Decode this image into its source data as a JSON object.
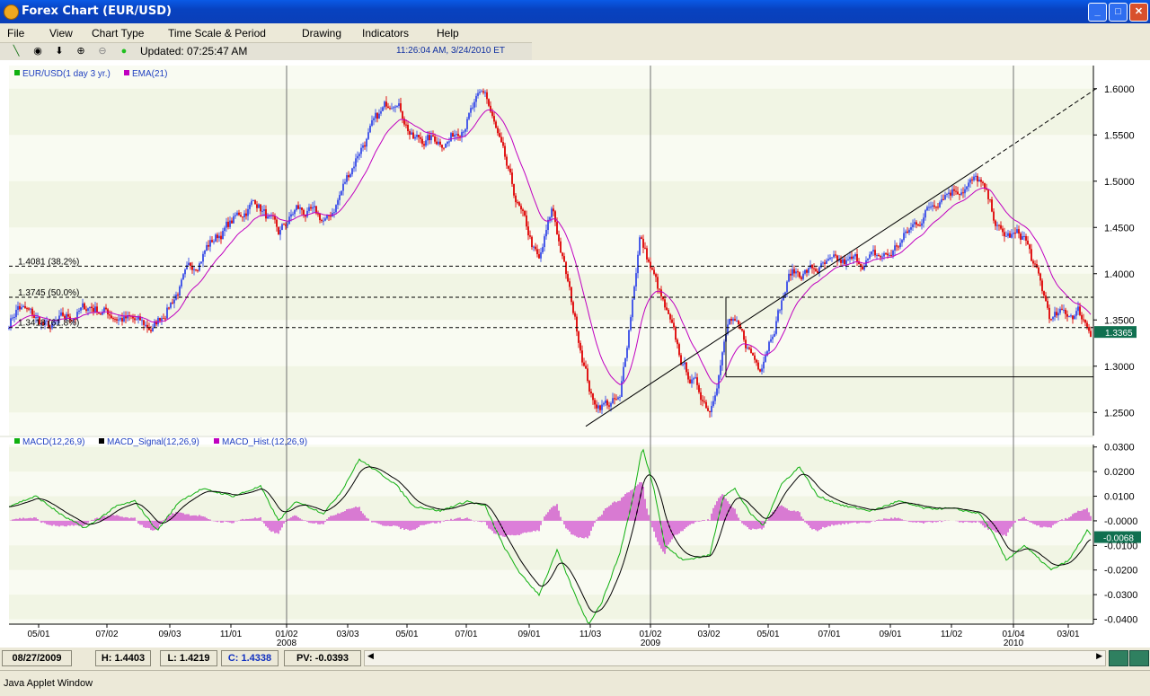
{
  "window": {
    "title": "Forex Chart (EUR/USD)",
    "minimize": "_",
    "maximize": "□",
    "close": "✕"
  },
  "menu": [
    "File",
    "View",
    "Chart Type",
    "Time Scale & Period",
    "Drawing",
    "Indicators",
    "Help"
  ],
  "toolbar": {
    "icons": [
      "pencil-icon",
      "target-icon",
      "down-arrow-icon",
      "zoom-in-icon",
      "zoom-out-icon",
      "status-dot-icon"
    ],
    "updated": "Updated: 07:25:47 AM",
    "server_time": "11:26:04 AM, 3/24/2010 ET"
  },
  "colors": {
    "up": "#4a5ce8",
    "down": "#e01818",
    "ema": "#c000c0",
    "macd": "#10b010",
    "signal": "#000000",
    "hist": "#c000c0",
    "band": "#f1f5e4",
    "price_tag": "#107050"
  },
  "chart_data": [
    {
      "type": "candlestick",
      "legend": [
        {
          "label": "EUR/USD(1 day  3 yr.)",
          "color": "#10b010"
        },
        {
          "label": "EMA(21)",
          "color": "#c000c0"
        }
      ],
      "ylim": [
        1.225,
        1.625
      ],
      "yticks": [
        "1.6000",
        "1.5500",
        "1.5000",
        "1.4500",
        "1.4000",
        "1.3500",
        "1.3000",
        "1.2500"
      ],
      "xticks": [
        "05/01",
        "07/02",
        "09/03",
        "11/01",
        "01/02",
        "03/03",
        "05/01",
        "07/01",
        "09/01",
        "11/03",
        "01/02",
        "03/02",
        "05/01",
        "07/01",
        "09/01",
        "11/02",
        "01/04",
        "03/01"
      ],
      "year_labels": [
        "2008",
        "2009",
        "2010"
      ],
      "fib_levels": [
        {
          "label": "1.4081 (38.2%)",
          "value": 1.4081
        },
        {
          "label": "1.3745 (50.0%)",
          "value": 1.3745
        },
        {
          "label": "1.3418 (61.8%)",
          "value": 1.3418
        }
      ],
      "last_price": "1.3365",
      "close_anchors": [
        [
          0,
          1.33
        ],
        [
          20,
          1.365
        ],
        [
          55,
          1.34
        ],
        [
          100,
          1.365
        ],
        [
          170,
          1.34
        ],
        [
          230,
          1.43
        ],
        [
          285,
          1.48
        ],
        [
          310,
          1.44
        ],
        [
          330,
          1.47
        ],
        [
          365,
          1.455
        ],
        [
          400,
          1.535
        ],
        [
          440,
          1.595
        ],
        [
          460,
          1.545
        ],
        [
          500,
          1.545
        ],
        [
          540,
          1.595
        ],
        [
          570,
          1.49
        ],
        [
          600,
          1.41
        ],
        [
          615,
          1.47
        ],
        [
          640,
          1.35
        ],
        [
          660,
          1.26
        ],
        [
          690,
          1.26
        ],
        [
          712,
          1.44
        ],
        [
          730,
          1.39
        ],
        [
          760,
          1.3
        ],
        [
          790,
          1.255
        ],
        [
          812,
          1.35
        ],
        [
          845,
          1.3
        ],
        [
          880,
          1.4
        ],
        [
          940,
          1.41
        ],
        [
          990,
          1.42
        ],
        [
          1050,
          1.49
        ],
        [
          1090,
          1.5
        ],
        [
          1115,
          1.44
        ],
        [
          1140,
          1.44
        ],
        [
          1170,
          1.35
        ],
        [
          1200,
          1.36
        ],
        [
          1217,
          1.336
        ]
      ],
      "trend_line": {
        "from": [
          "11/03/2008",
          1.235
        ],
        "to": [
          "03/24/2010",
          1.6
        ]
      },
      "support_line": {
        "value": 1.2885,
        "from": "03/02/2009",
        "to": "03/24/2010"
      }
    },
    {
      "type": "line",
      "legend": [
        {
          "label": "MACD(12,26,9)",
          "color": "#10b010"
        },
        {
          "label": "MACD_Signal(12,26,9)",
          "color": "#000000"
        },
        {
          "label": "MACD_Hist.(12,26,9)",
          "color": "#c000c0"
        }
      ],
      "ylim": [
        -0.042,
        0.031
      ],
      "yticks": [
        "0.0300",
        "0.0200",
        "0.0100",
        "-0.0000",
        "-0.0100",
        "-0.0200",
        "-0.0300",
        "-0.0400"
      ],
      "macd_anchors": [
        [
          10,
          0.006
        ],
        [
          40,
          0.01
        ],
        [
          70,
          0.002
        ],
        [
          95,
          -0.003
        ],
        [
          130,
          0.006
        ],
        [
          150,
          0.008
        ],
        [
          175,
          -0.004
        ],
        [
          200,
          0.008
        ],
        [
          225,
          0.013
        ],
        [
          260,
          0.01
        ],
        [
          290,
          0.014
        ],
        [
          310,
          0.0
        ],
        [
          330,
          0.008
        ],
        [
          360,
          0.003
        ],
        [
          380,
          0.012
        ],
        [
          400,
          0.025
        ],
        [
          420,
          0.02
        ],
        [
          440,
          0.015
        ],
        [
          460,
          0.006
        ],
        [
          490,
          0.004
        ],
        [
          520,
          0.008
        ],
        [
          540,
          0.006
        ],
        [
          560,
          -0.01
        ],
        [
          580,
          -0.022
        ],
        [
          600,
          -0.03
        ],
        [
          620,
          -0.012
        ],
        [
          640,
          -0.03
        ],
        [
          655,
          -0.042
        ],
        [
          670,
          -0.033
        ],
        [
          690,
          -0.013
        ],
        [
          705,
          0.01
        ],
        [
          715,
          0.03
        ],
        [
          728,
          0.013
        ],
        [
          740,
          -0.01
        ],
        [
          760,
          -0.016
        ],
        [
          790,
          -0.014
        ],
        [
          805,
          0.01
        ],
        [
          818,
          0.013
        ],
        [
          835,
          0.003
        ],
        [
          850,
          -0.002
        ],
        [
          870,
          0.015
        ],
        [
          890,
          0.022
        ],
        [
          910,
          0.01
        ],
        [
          940,
          0.006
        ],
        [
          970,
          0.004
        ],
        [
          1000,
          0.008
        ],
        [
          1030,
          0.005
        ],
        [
          1060,
          0.005
        ],
        [
          1090,
          0.003
        ],
        [
          1105,
          -0.005
        ],
        [
          1120,
          -0.016
        ],
        [
          1140,
          -0.01
        ],
        [
          1170,
          -0.02
        ],
        [
          1190,
          -0.016
        ],
        [
          1210,
          -0.004
        ],
        [
          1217,
          -0.007
        ]
      ],
      "last_value": "-0.0068"
    }
  ],
  "status": {
    "date": "08/27/2009",
    "high": "H: 1.4403",
    "low": "L: 1.4219",
    "close": "C: 1.4338",
    "pv": "PV: -0.0393"
  },
  "bottom": {
    "applet": "Java Applet Window"
  }
}
